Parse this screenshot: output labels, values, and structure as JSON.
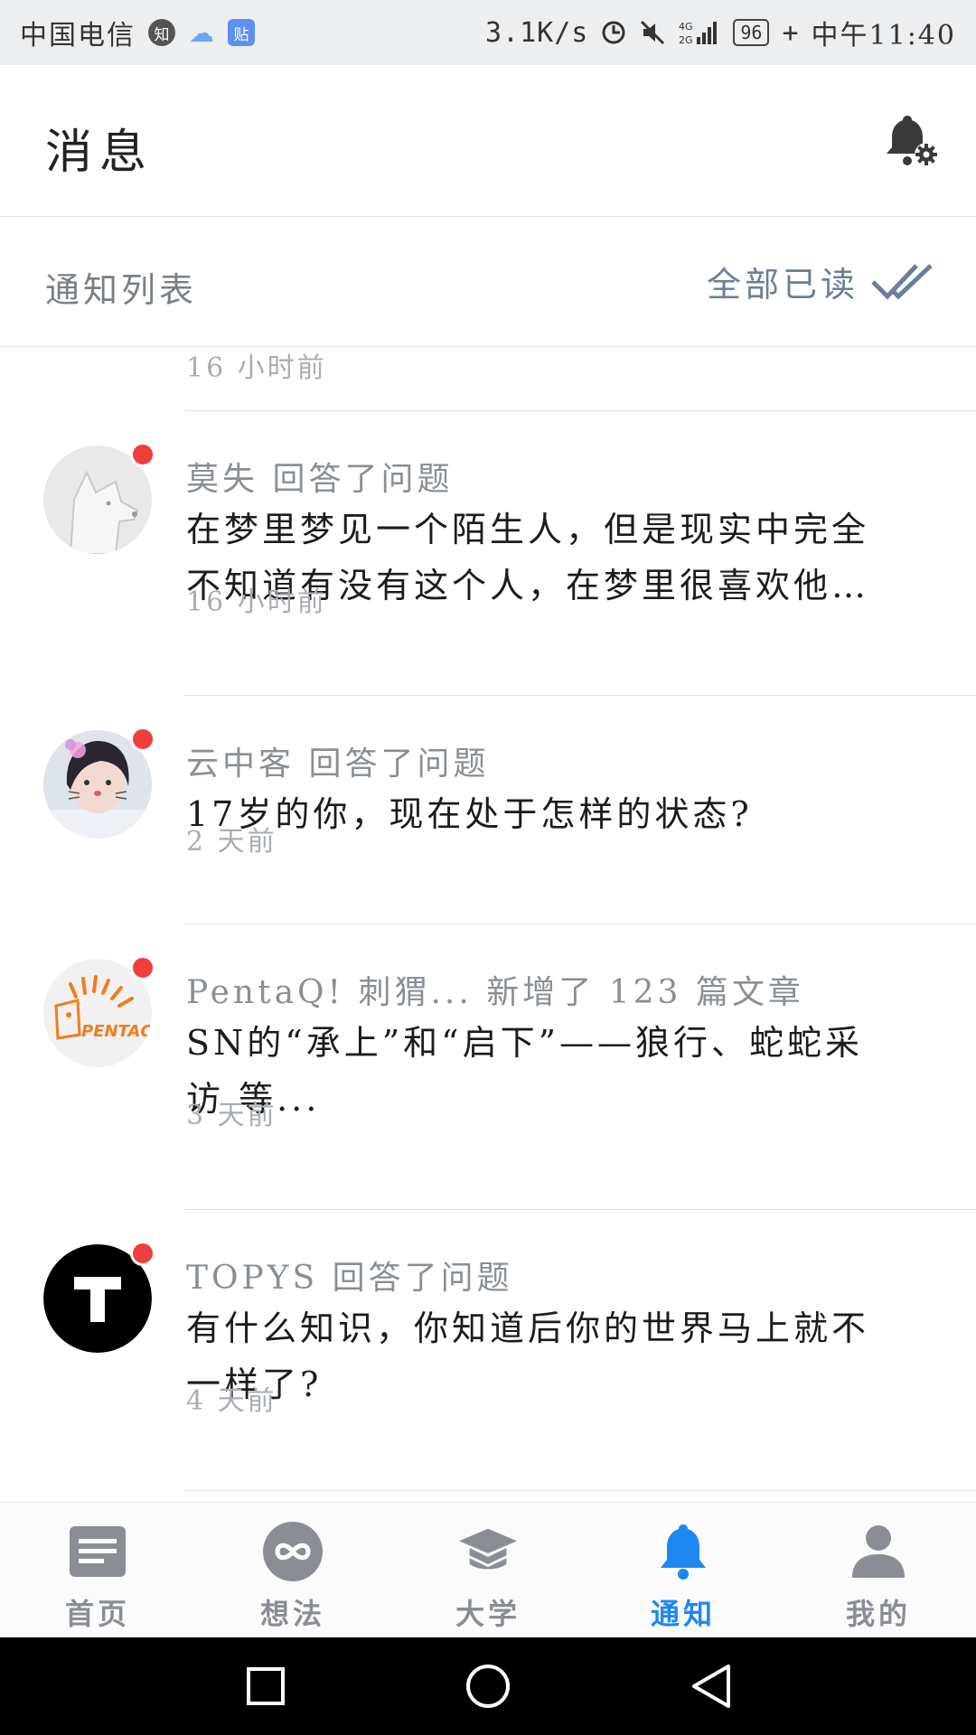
{
  "status_bar": {
    "carrier": "中国电信",
    "badges": [
      "知",
      "贴"
    ],
    "speed": "3.1K/s",
    "network": "4G 2G",
    "battery": "96",
    "time": "中午11:40"
  },
  "header": {
    "title": "消息",
    "settings_icon": "bell-settings-icon"
  },
  "subheader": {
    "title": "通知列表",
    "mark_all_label": "全部已读",
    "mark_all_icon": "double-check-icon"
  },
  "list": {
    "partial_time": "16 小时前",
    "items": [
      {
        "actor": "莫失 回答了问题",
        "content": "在梦里梦见一个陌生人，但是现实中完全不知道有没有这个人，在梦里很喜欢他…",
        "time": "16 小时前",
        "unread": true,
        "avatar": "dog-sketch-avatar"
      },
      {
        "actor": "云中客 回答了问题",
        "content": "17岁的你，现在处于怎样的状态?",
        "time": "2 天前",
        "unread": true,
        "avatar": "girl-photo-avatar"
      },
      {
        "actor": "PentaQ! 刺猬... 新增了 123 篇文章",
        "content": "SN的“承上”和“启下”——狼行、蛇蛇采访 等...",
        "time": "3 天前",
        "unread": true,
        "avatar": "pentaq-logo-avatar"
      },
      {
        "actor": "TOPYS 回答了问题",
        "content": "有什么知识，你知道后你的世界马上就不一样了?",
        "time": "4 天前",
        "unread": true,
        "avatar": "topys-logo-avatar"
      }
    ]
  },
  "bottom_nav": {
    "items": [
      {
        "label": "首页",
        "icon": "feed-icon",
        "active": false
      },
      {
        "label": "想法",
        "icon": "infinity-icon",
        "active": false
      },
      {
        "label": "大学",
        "icon": "graduation-cap-icon",
        "active": false
      },
      {
        "label": "通知",
        "icon": "bell-icon",
        "active": true
      },
      {
        "label": "我的",
        "icon": "person-icon",
        "active": false
      }
    ]
  },
  "colors": {
    "accent": "#1e88f0",
    "unread_dot": "#f23d3d",
    "secondary_text": "#8a8f96",
    "muted_text": "#a9adb3",
    "mark_all": "#6e7e9a"
  }
}
